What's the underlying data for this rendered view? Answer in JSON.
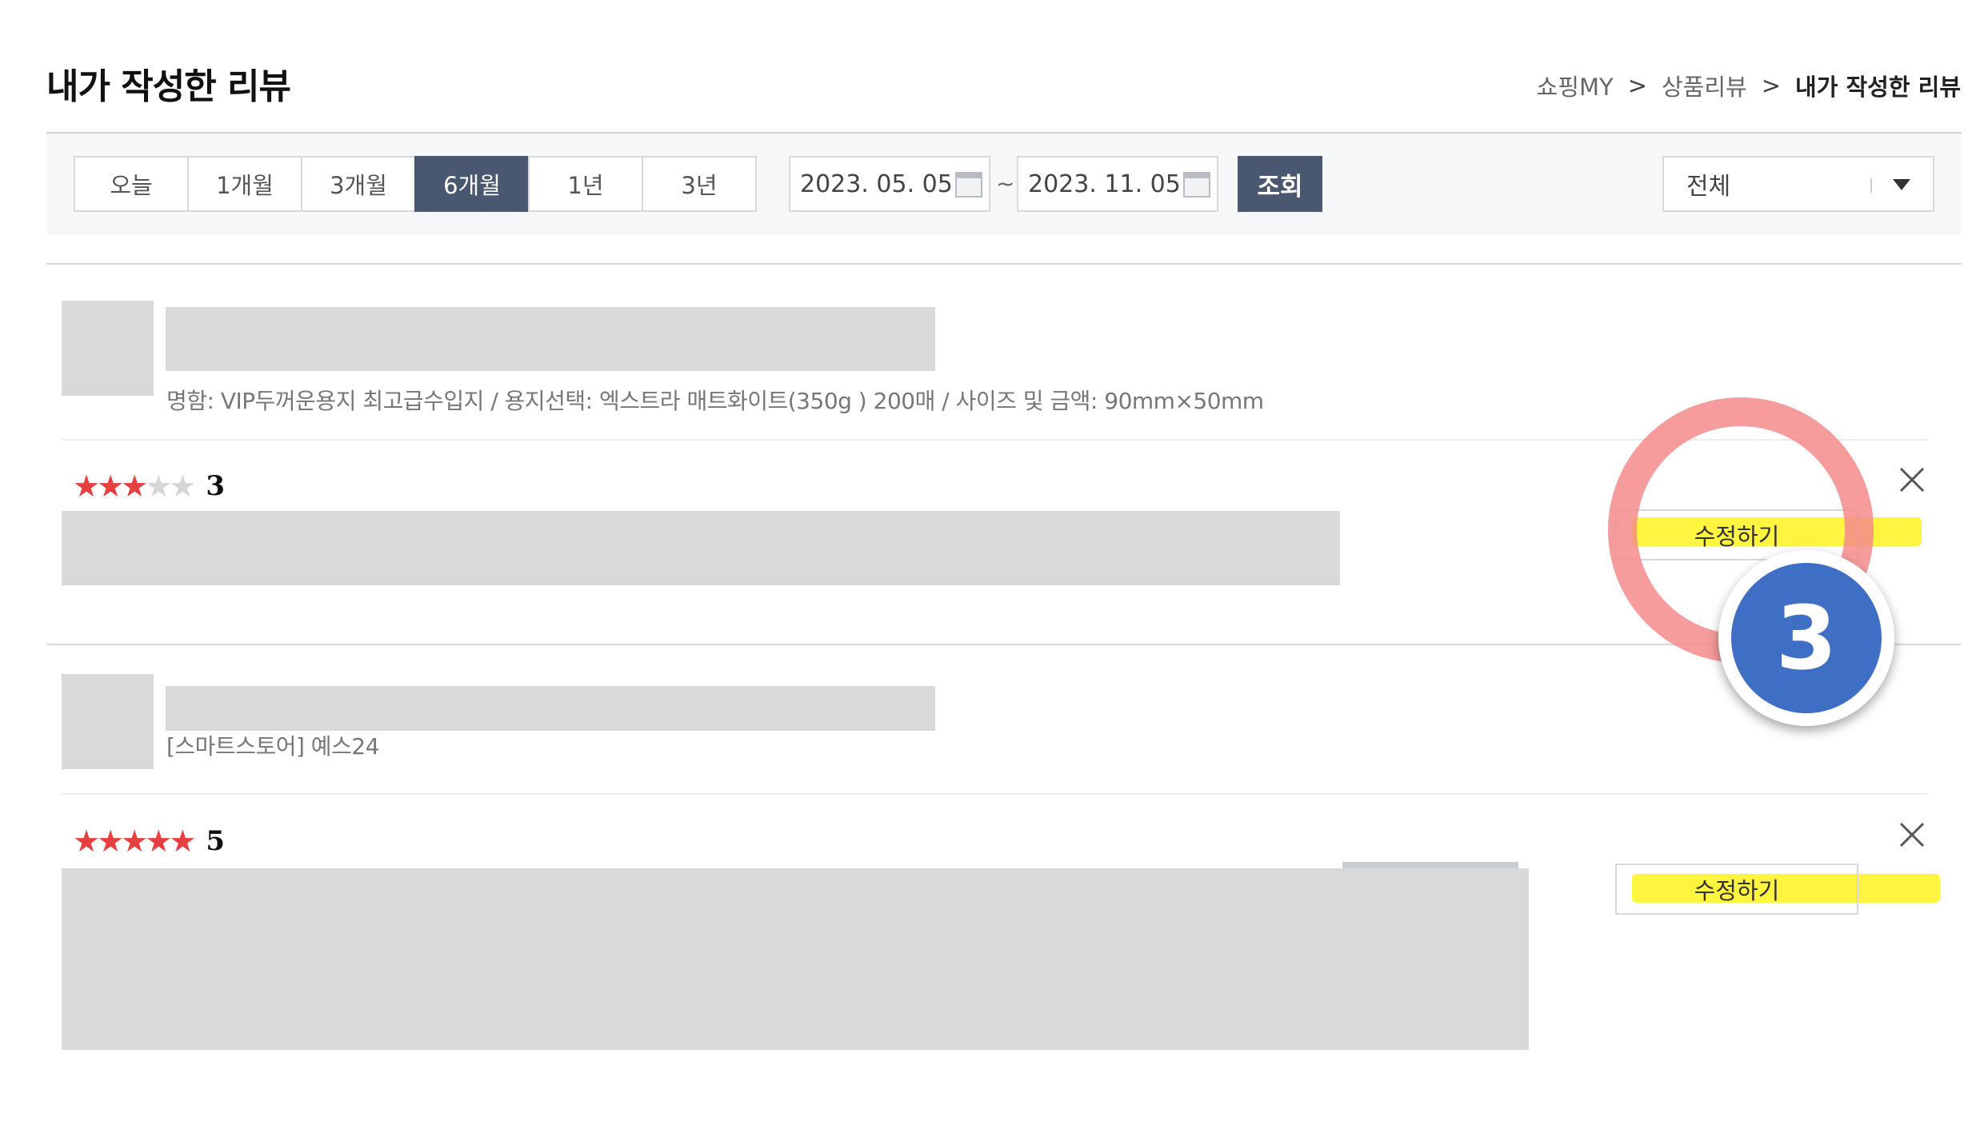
{
  "page": {
    "title": "내가 작성한 리뷰"
  },
  "breadcrumb": {
    "items": [
      "쇼핑MY",
      "상품리뷰",
      "내가 작성한 리뷰"
    ],
    "separator": ">"
  },
  "filter": {
    "periods": [
      "오늘",
      "1개월",
      "3개월",
      "6개월",
      "1년",
      "3년"
    ],
    "active_period": "6개월",
    "start_date": "2023. 05. 05.",
    "end_date": "2023. 11. 05.",
    "date_separator": "~",
    "search_label": "조회",
    "select_value": "전체"
  },
  "reviews": [
    {
      "option_text": "명함: VIP두꺼운용지 최고급수입지 / 용지선택: 엑스트라 매트화이트(350g ) 200매 / 사이즈 및 금액: 90mm×50mm",
      "rating": 3,
      "rating_label": "3",
      "edit_label": "수정하기"
    },
    {
      "option_text": "[스마트스토어] 예스24",
      "rating": 5,
      "rating_label": "5",
      "edit_label": "수정하기"
    }
  ],
  "annotation": {
    "step_number": "3",
    "ring_color": "#f48b8b",
    "badge_color": "#3f6fc4",
    "highlight_color": "#fff200"
  },
  "colors": {
    "accent": "#4a5770",
    "star": "#e63f3f"
  }
}
